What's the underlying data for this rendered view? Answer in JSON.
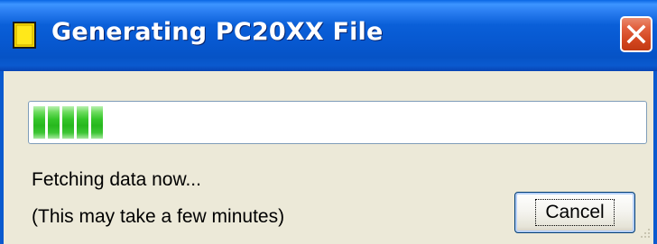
{
  "window": {
    "title": "Generating PC20XX File",
    "app_icon": "yellow-document-icon",
    "close_icon": "close-icon"
  },
  "progress": {
    "fraction": 0.1,
    "chunks": 5,
    "fill_color": "#35C52A"
  },
  "status": {
    "line1": "Fetching data now...",
    "line2": "(This may take a few minutes)"
  },
  "buttons": {
    "cancel_label": "Cancel"
  },
  "colors": {
    "titlebar": "#0A5FD8",
    "close_button": "#D2451E",
    "dialog_background": "#ECE9D8"
  }
}
